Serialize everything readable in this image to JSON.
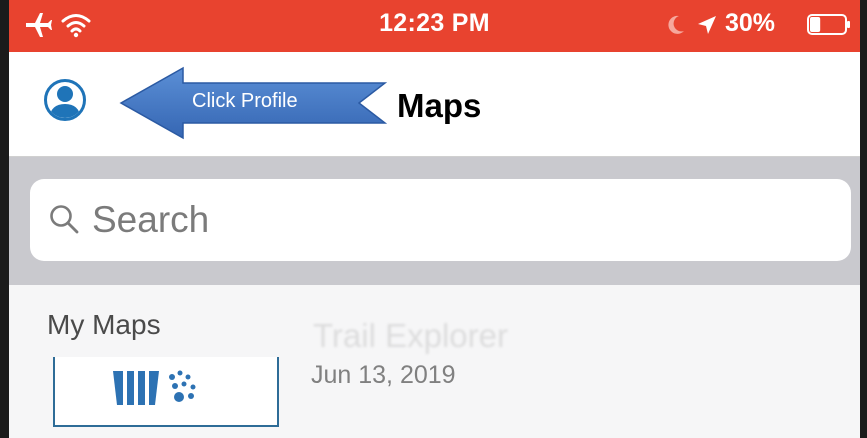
{
  "status_bar": {
    "time": "12:23 PM",
    "battery_percent": "30%",
    "battery_level": 0.3,
    "icons": [
      "airplane-icon",
      "wifi-icon",
      "moon-icon",
      "location-arrow-icon",
      "battery-icon"
    ],
    "background_color": "#e8432f"
  },
  "nav_bar": {
    "title": "Maps",
    "profile_icon": "user-circle-icon",
    "accent_color": "#1f74b8"
  },
  "annotation": {
    "callout_text": "Click Profile",
    "callout_color": "#3f75c4"
  },
  "search": {
    "placeholder": "Search",
    "value": ""
  },
  "my_maps": {
    "section_label": "My Maps",
    "items": [
      {
        "title": "Trail Explorer",
        "date": "Jun 13, 2019",
        "thumbnail_icon": "basket-dots-icon"
      }
    ]
  }
}
